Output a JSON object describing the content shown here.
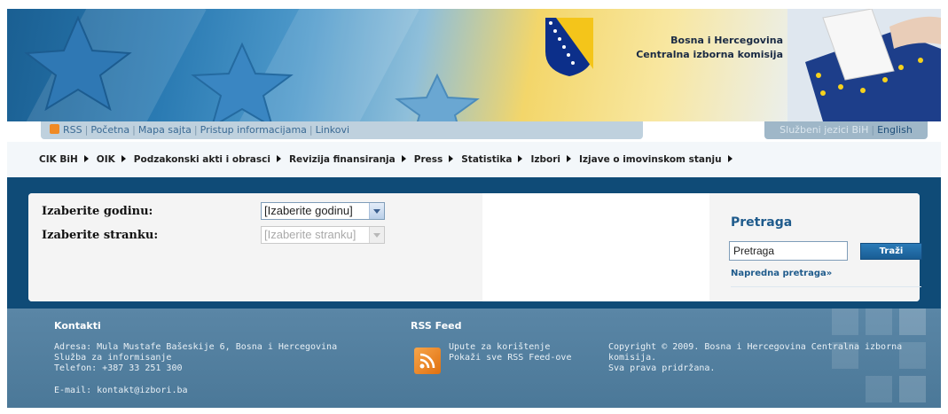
{
  "banner": {
    "title_line1": "Bosna i Hercegovina",
    "title_line2": "Centralna izborna komisija"
  },
  "top_links": {
    "rss": "RSS",
    "home": "Početna",
    "sitemap": "Mapa sajta",
    "info_access": "Pristup informacijama",
    "links": "Linkovi"
  },
  "languages": {
    "official": "Službeni jezici BiH",
    "english": "English"
  },
  "main_nav": {
    "items": [
      "CIK BiH",
      "OIK",
      "Podzakonski akti i obrasci",
      "Revizija finansiranja",
      "Press",
      "Statistika",
      "Izbori",
      "Izjave o imovinskom stanju"
    ]
  },
  "filters": {
    "year_label": "Izaberite godinu:",
    "year_value": "[Izaberite godinu]",
    "party_label": "Izaberite stranku:",
    "party_value": "[Izaberite stranku]"
  },
  "search": {
    "title": "Pretraga",
    "input_value": "Pretraga",
    "button_label": "Traži",
    "advanced": "Napredna pretraga»"
  },
  "footer": {
    "contact_title": "Kontakti",
    "address": "Adresa: Mula Mustafe Bašeskije 6, Bosna i Hercegovina",
    "service": "Služba za informisanje",
    "phone": "Telefon: +387 33 251 300",
    "email": "E-mail: kontakt@izbori.ba",
    "rss_title": "RSS Feed",
    "rss_usage": "Upute za korištenje",
    "rss_all": "Pokaži sve RSS Feed-ove",
    "copyright_line1": "Copyright © 2009. Bosna i Hercegovina Centralna izborna",
    "copyright_line2": "komisija.",
    "copyright_line3": "Sva prava pridržana."
  },
  "colors": {
    "content_bg": "#0f4b77",
    "footer_bg": "#5a86a6",
    "accent": "#1f5b8c"
  }
}
